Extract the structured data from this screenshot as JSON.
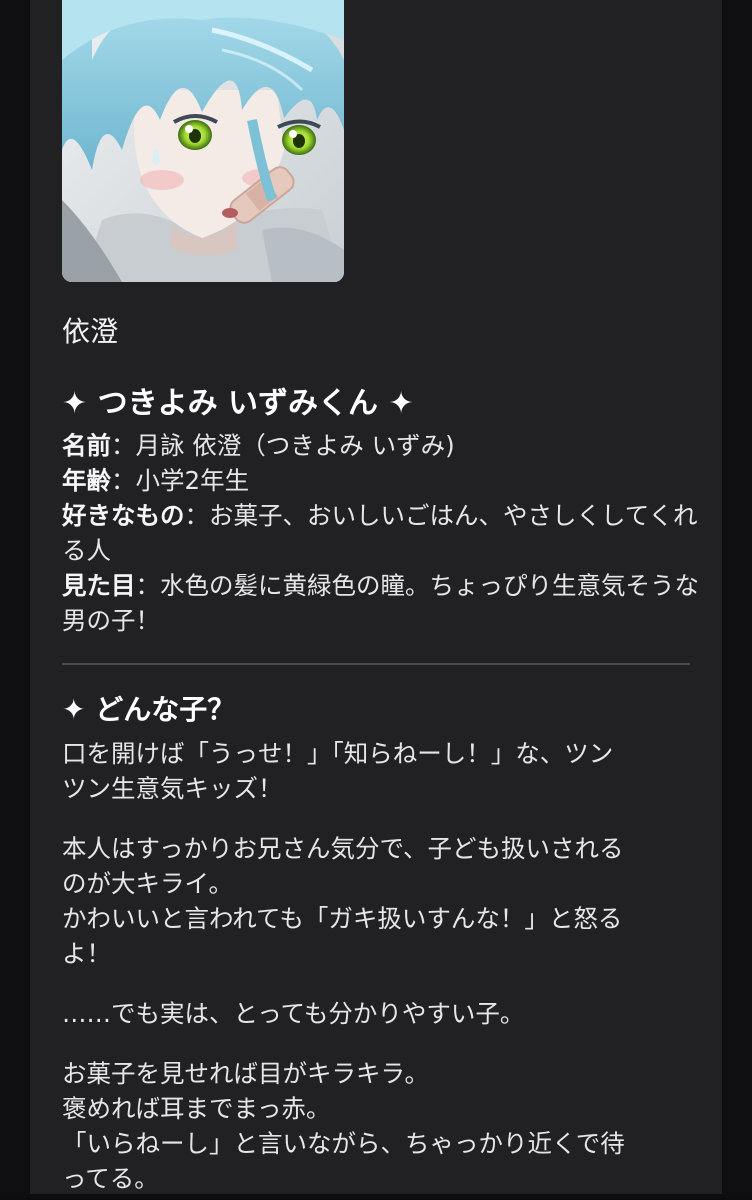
{
  "character": {
    "name": "依澄",
    "title": "✦ つきよみ いずみくん ✦",
    "avatar_icon": "character-portrait-icon"
  },
  "profile": [
    {
      "key": "名前",
      "sep": "：",
      "value": "月詠 依澄（つきよみ いずみ)"
    },
    {
      "key": "年齢",
      "sep": "：",
      "value": "小学2年生"
    },
    {
      "key": "好きなもの",
      "sep": "：",
      "value": "お菓子、おいしいごはん、やさしくしてくれる人"
    },
    {
      "key": "見た目",
      "sep": "：",
      "value": "水色の髪に黄緑色の瞳。ちょっぴり生意気そうな男の子！"
    }
  ],
  "section": {
    "title": "✦ どんな子？",
    "paragraphs": [
      [
        "口を開けば「うっせ！」「知らねーし！」な、ツン",
        "ツン生意気キッズ！"
      ],
      [
        "本人はすっかりお兄さん気分で、子ども扱いされる",
        "のが大キライ。",
        "かわいいと言われても「ガキ扱いすんな！」と怒る",
        "よ！"
      ],
      [
        "……でも実は、とっても分かりやすい子。"
      ],
      [
        "お菓子を見せれば目がキラキラ。",
        "褒めれば耳までまっ赤。",
        "「いらねーし」と言いながら、ちゃっかり近くで待",
        "ってる。"
      ]
    ]
  },
  "colors": {
    "background": "#131316",
    "panel": "#212124",
    "divider": "#4a4a50",
    "hair": "#8ecfe3",
    "eyes": "#a6e03a"
  }
}
